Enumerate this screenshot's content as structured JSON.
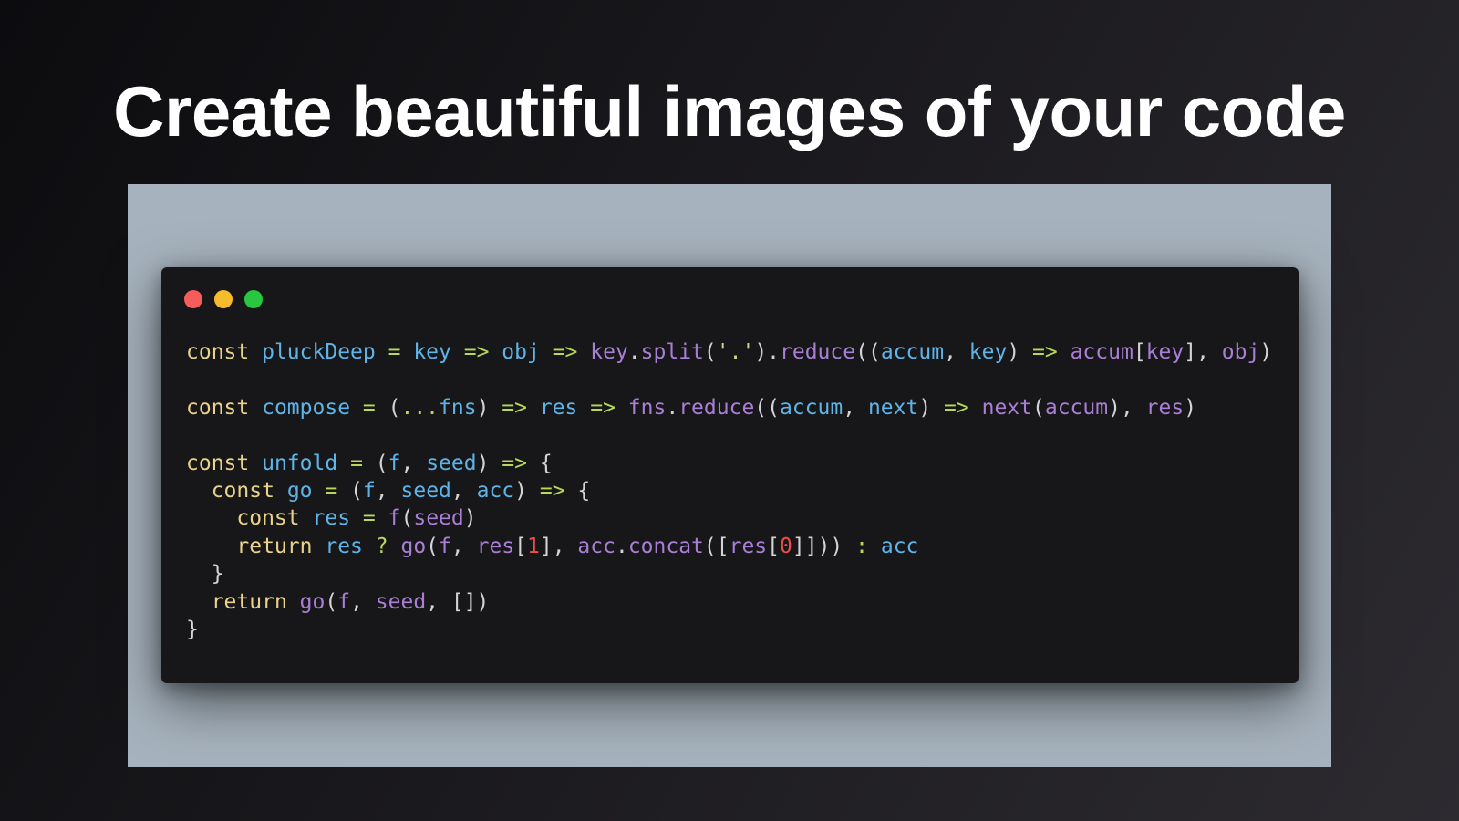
{
  "headline": "Create beautiful images of your code",
  "colors": {
    "canvas_background": "#a6b2bd",
    "window_background": "#171719",
    "control_close": "#f55c5a",
    "control_minimize": "#f7bb2e",
    "control_maximize": "#29c741",
    "keyword": "#e9d38a",
    "definition": "#5fb3e6",
    "property": "#a97fd6",
    "operator": "#b7d85c",
    "number": "#ef4d4d"
  },
  "window_controls": [
    {
      "name": "close-control",
      "color": "#f55c5a"
    },
    {
      "name": "minimize-control",
      "color": "#f7bb2e"
    },
    {
      "name": "maximize-control",
      "color": "#29c741"
    }
  ],
  "code_lines": [
    [
      {
        "t": "keyword",
        "v": "const"
      },
      {
        "t": "punct",
        "v": " "
      },
      {
        "t": "def",
        "v": "pluckDeep"
      },
      {
        "t": "punct",
        "v": " "
      },
      {
        "t": "operator",
        "v": "="
      },
      {
        "t": "punct",
        "v": " "
      },
      {
        "t": "var",
        "v": "key"
      },
      {
        "t": "punct",
        "v": " "
      },
      {
        "t": "operator",
        "v": "=>"
      },
      {
        "t": "punct",
        "v": " "
      },
      {
        "t": "var",
        "v": "obj"
      },
      {
        "t": "punct",
        "v": " "
      },
      {
        "t": "operator",
        "v": "=>"
      },
      {
        "t": "punct",
        "v": " "
      },
      {
        "t": "prop",
        "v": "key"
      },
      {
        "t": "punct",
        "v": "."
      },
      {
        "t": "prop",
        "v": "split"
      },
      {
        "t": "punct",
        "v": "("
      },
      {
        "t": "string",
        "v": "'.'"
      },
      {
        "t": "punct",
        "v": ")."
      },
      {
        "t": "prop",
        "v": "reduce"
      },
      {
        "t": "punct",
        "v": "(("
      },
      {
        "t": "var",
        "v": "accum"
      },
      {
        "t": "punct",
        "v": ", "
      },
      {
        "t": "var",
        "v": "key"
      },
      {
        "t": "punct",
        "v": ") "
      },
      {
        "t": "operator",
        "v": "=>"
      },
      {
        "t": "punct",
        "v": " "
      },
      {
        "t": "prop",
        "v": "accum"
      },
      {
        "t": "punct",
        "v": "["
      },
      {
        "t": "prop",
        "v": "key"
      },
      {
        "t": "punct",
        "v": "], "
      },
      {
        "t": "prop",
        "v": "obj"
      },
      {
        "t": "punct",
        "v": ")"
      }
    ],
    [],
    [
      {
        "t": "keyword",
        "v": "const"
      },
      {
        "t": "punct",
        "v": " "
      },
      {
        "t": "def",
        "v": "compose"
      },
      {
        "t": "punct",
        "v": " "
      },
      {
        "t": "operator",
        "v": "="
      },
      {
        "t": "punct",
        "v": " ("
      },
      {
        "t": "operator",
        "v": "..."
      },
      {
        "t": "var",
        "v": "fns"
      },
      {
        "t": "punct",
        "v": ") "
      },
      {
        "t": "operator",
        "v": "=>"
      },
      {
        "t": "punct",
        "v": " "
      },
      {
        "t": "var",
        "v": "res"
      },
      {
        "t": "punct",
        "v": " "
      },
      {
        "t": "operator",
        "v": "=>"
      },
      {
        "t": "punct",
        "v": " "
      },
      {
        "t": "prop",
        "v": "fns"
      },
      {
        "t": "punct",
        "v": "."
      },
      {
        "t": "prop",
        "v": "reduce"
      },
      {
        "t": "punct",
        "v": "(("
      },
      {
        "t": "var",
        "v": "accum"
      },
      {
        "t": "punct",
        "v": ", "
      },
      {
        "t": "var",
        "v": "next"
      },
      {
        "t": "punct",
        "v": ") "
      },
      {
        "t": "operator",
        "v": "=>"
      },
      {
        "t": "punct",
        "v": " "
      },
      {
        "t": "prop",
        "v": "next"
      },
      {
        "t": "punct",
        "v": "("
      },
      {
        "t": "prop",
        "v": "accum"
      },
      {
        "t": "punct",
        "v": "), "
      },
      {
        "t": "prop",
        "v": "res"
      },
      {
        "t": "punct",
        "v": ")"
      }
    ],
    [],
    [
      {
        "t": "keyword",
        "v": "const"
      },
      {
        "t": "punct",
        "v": " "
      },
      {
        "t": "def",
        "v": "unfold"
      },
      {
        "t": "punct",
        "v": " "
      },
      {
        "t": "operator",
        "v": "="
      },
      {
        "t": "punct",
        "v": " ("
      },
      {
        "t": "var",
        "v": "f"
      },
      {
        "t": "punct",
        "v": ", "
      },
      {
        "t": "var",
        "v": "seed"
      },
      {
        "t": "punct",
        "v": ") "
      },
      {
        "t": "operator",
        "v": "=>"
      },
      {
        "t": "punct",
        "v": " {"
      }
    ],
    [
      {
        "t": "punct",
        "v": "  "
      },
      {
        "t": "keyword",
        "v": "const"
      },
      {
        "t": "punct",
        "v": " "
      },
      {
        "t": "def",
        "v": "go"
      },
      {
        "t": "punct",
        "v": " "
      },
      {
        "t": "operator",
        "v": "="
      },
      {
        "t": "punct",
        "v": " ("
      },
      {
        "t": "var",
        "v": "f"
      },
      {
        "t": "punct",
        "v": ", "
      },
      {
        "t": "var",
        "v": "seed"
      },
      {
        "t": "punct",
        "v": ", "
      },
      {
        "t": "var",
        "v": "acc"
      },
      {
        "t": "punct",
        "v": ") "
      },
      {
        "t": "operator",
        "v": "=>"
      },
      {
        "t": "punct",
        "v": " {"
      }
    ],
    [
      {
        "t": "punct",
        "v": "    "
      },
      {
        "t": "keyword",
        "v": "const"
      },
      {
        "t": "punct",
        "v": " "
      },
      {
        "t": "def",
        "v": "res"
      },
      {
        "t": "punct",
        "v": " "
      },
      {
        "t": "operator",
        "v": "="
      },
      {
        "t": "punct",
        "v": " "
      },
      {
        "t": "prop",
        "v": "f"
      },
      {
        "t": "punct",
        "v": "("
      },
      {
        "t": "prop",
        "v": "seed"
      },
      {
        "t": "punct",
        "v": ")"
      }
    ],
    [
      {
        "t": "punct",
        "v": "    "
      },
      {
        "t": "keyword",
        "v": "return"
      },
      {
        "t": "punct",
        "v": " "
      },
      {
        "t": "var",
        "v": "res"
      },
      {
        "t": "punct",
        "v": " "
      },
      {
        "t": "operator",
        "v": "?"
      },
      {
        "t": "punct",
        "v": " "
      },
      {
        "t": "prop",
        "v": "go"
      },
      {
        "t": "punct",
        "v": "("
      },
      {
        "t": "prop",
        "v": "f"
      },
      {
        "t": "punct",
        "v": ", "
      },
      {
        "t": "prop",
        "v": "res"
      },
      {
        "t": "punct",
        "v": "["
      },
      {
        "t": "number",
        "v": "1"
      },
      {
        "t": "punct",
        "v": "], "
      },
      {
        "t": "prop",
        "v": "acc"
      },
      {
        "t": "punct",
        "v": "."
      },
      {
        "t": "prop",
        "v": "concat"
      },
      {
        "t": "punct",
        "v": "(["
      },
      {
        "t": "prop",
        "v": "res"
      },
      {
        "t": "punct",
        "v": "["
      },
      {
        "t": "number",
        "v": "0"
      },
      {
        "t": "punct",
        "v": "]])) "
      },
      {
        "t": "operator",
        "v": ":"
      },
      {
        "t": "punct",
        "v": " "
      },
      {
        "t": "var",
        "v": "acc"
      }
    ],
    [
      {
        "t": "punct",
        "v": "  }"
      }
    ],
    [
      {
        "t": "punct",
        "v": "  "
      },
      {
        "t": "keyword",
        "v": "return"
      },
      {
        "t": "punct",
        "v": " "
      },
      {
        "t": "prop",
        "v": "go"
      },
      {
        "t": "punct",
        "v": "("
      },
      {
        "t": "prop",
        "v": "f"
      },
      {
        "t": "punct",
        "v": ", "
      },
      {
        "t": "prop",
        "v": "seed"
      },
      {
        "t": "punct",
        "v": ", [])"
      }
    ],
    [
      {
        "t": "punct",
        "v": "}"
      }
    ]
  ]
}
